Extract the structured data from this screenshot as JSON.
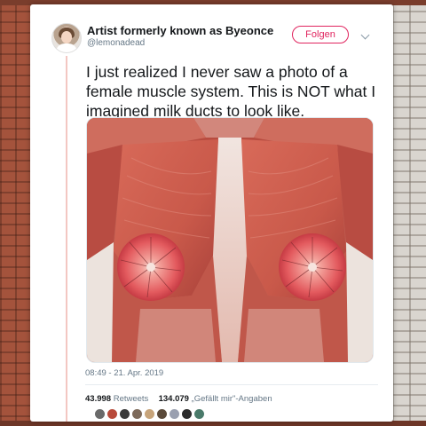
{
  "tweet": {
    "display_name": "Artist formerly known as Byeonce",
    "handle": "@lemonadead",
    "follow_label": "Folgen",
    "text": "I just realized I never saw a photo of a female muscle system. This is NOT what I imagined milk ducts to look like.",
    "timestamp": "08:49 - 21. Apr. 2019",
    "retweets_count": "43.998",
    "retweets_label": "Retweets",
    "likes_count": "134.079",
    "likes_label": "„Gefällt mir\"-Angaben"
  },
  "liker_avatars": [
    "#6a6a6a",
    "#b84a3a",
    "#3a3a3a",
    "#7d6a5a",
    "#c7a47a",
    "#5a4a3a",
    "#9aa0b0",
    "#2c2c2c",
    "#4a7a6a"
  ],
  "colors": {
    "follow_accent": "#e0245e",
    "thread_line": "#f3c7c2",
    "muscle_red": "#c9594a"
  },
  "icons": {
    "more": "chevron-down-icon"
  }
}
